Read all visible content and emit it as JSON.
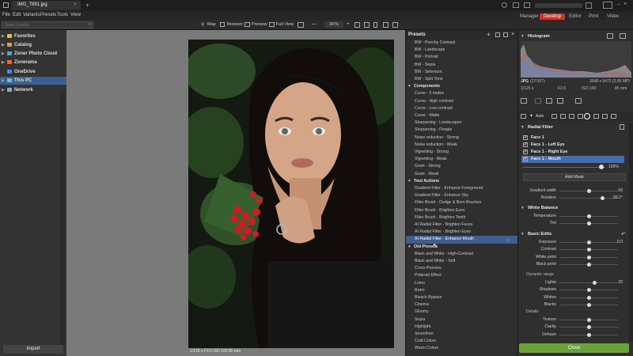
{
  "window": {
    "title": "IMG_7891.jpg",
    "new_tab": "+"
  },
  "menu": [
    "File",
    "Edit",
    "Variants",
    "Presets",
    "Tools",
    "View"
  ],
  "modes": {
    "manager": "Manager",
    "develop": "Develop",
    "editor": "Editor",
    "print": "Print",
    "video": "Video"
  },
  "toolbar": {
    "search_placeholder": "Quick Search",
    "map": "Map",
    "browser": "Browser",
    "preview": "Preview",
    "fullview": "Full View",
    "zoom": "34 %"
  },
  "navigator": [
    {
      "label": "Favorites",
      "color": "#e0c040"
    },
    {
      "label": "Catalog",
      "color": "#c9a35a"
    },
    {
      "label": "Zoner Photo Cloud",
      "color": "#5aa0e0"
    },
    {
      "label": "Zonerama",
      "color": "#e06a3a"
    },
    {
      "label": "OneDrive",
      "color": "#4a90d9"
    },
    {
      "label": "This PC",
      "color": "#7ab0e0"
    },
    {
      "label": "Network",
      "color": "#7ab0e0"
    }
  ],
  "left_footer": {
    "import": "Import"
  },
  "image_info": "1/125 s   F3.5   ISO 100   85 mm",
  "presets": {
    "title": "Presets",
    "items": [
      {
        "type": "item",
        "label": "BW - Punchy Contrast"
      },
      {
        "type": "item",
        "label": "BW - Landscape"
      },
      {
        "type": "item",
        "label": "BW - Portrait"
      },
      {
        "type": "item",
        "label": "BW - Sepia"
      },
      {
        "type": "item",
        "label": "BW - Selenium"
      },
      {
        "type": "item",
        "label": "BW - Split Tone"
      },
      {
        "type": "header",
        "label": "Components"
      },
      {
        "type": "item",
        "label": "Curve - 5 nodes"
      },
      {
        "type": "item",
        "label": "Curve - High contrast"
      },
      {
        "type": "item",
        "label": "Curve - Low contrast"
      },
      {
        "type": "item",
        "label": "Curve - Matte"
      },
      {
        "type": "item",
        "label": "Sharpening - Landscapes"
      },
      {
        "type": "item",
        "label": "Sharpening - People"
      },
      {
        "type": "item",
        "label": "Noise reduction - Strong"
      },
      {
        "type": "item",
        "label": "Noise reduction - Weak"
      },
      {
        "type": "item",
        "label": "Vignetting - Strong"
      },
      {
        "type": "item",
        "label": "Vignetting - Weak"
      },
      {
        "type": "item",
        "label": "Grain - Strong"
      },
      {
        "type": "item",
        "label": "Grain - Weak"
      },
      {
        "type": "header",
        "label": "Tool Actions"
      },
      {
        "type": "item",
        "label": "Gradient Filter - Enhance Foreground"
      },
      {
        "type": "item",
        "label": "Gradient Filter - Enhance Sky"
      },
      {
        "type": "item",
        "label": "Filter Brush - Dodge & Burn Brushes"
      },
      {
        "type": "item",
        "label": "Filter Brush - Brighten Eyes"
      },
      {
        "type": "item",
        "label": "Filter Brush - Brighten Teeth"
      },
      {
        "type": "item",
        "label": "AI Radial Filter - Brighten Faces"
      },
      {
        "type": "item",
        "label": "AI Radial Filter - Brighten Eyes"
      },
      {
        "type": "item",
        "label": "AI Radial Filter - Enhance Mouth",
        "selected": true
      },
      {
        "type": "header",
        "label": "Old Presets"
      },
      {
        "type": "item",
        "label": "Black and White - High-Contrast"
      },
      {
        "type": "item",
        "label": "Black and White - Soft"
      },
      {
        "type": "item",
        "label": "Cross Process"
      },
      {
        "type": "item",
        "label": "Polaroid Effect"
      },
      {
        "type": "item",
        "label": "Lomo"
      },
      {
        "type": "item",
        "label": "Retro"
      },
      {
        "type": "item",
        "label": "Bleach Bypass"
      },
      {
        "type": "item",
        "label": "Cinema"
      },
      {
        "type": "item",
        "label": "Gloomy"
      },
      {
        "type": "item",
        "label": "Sepia"
      },
      {
        "type": "item",
        "label": "Highlight"
      },
      {
        "type": "item",
        "label": "Smoothen"
      },
      {
        "type": "item",
        "label": "Cold Colors"
      },
      {
        "type": "item",
        "label": "Warm Colors"
      }
    ]
  },
  "histogram": {
    "title": "Histogram",
    "format": "JPG",
    "bitinfo": "(27/167)",
    "dims": "3648 x 5472 (3.96 MP)",
    "shutter": "1/125 s",
    "aperture": "F3.5",
    "iso": "ISO 100",
    "focal": "85 mm"
  },
  "auto_label": "Auto",
  "radial": {
    "title": "Radial Filter",
    "layers": [
      {
        "label": "Face 1",
        "checked": true
      },
      {
        "label": "Face 1 - Left Eye",
        "checked": true
      },
      {
        "label": "Face 1 - Right Eye",
        "checked": true
      },
      {
        "label": "Face 1 - Mouth",
        "checked": true,
        "selected": true
      }
    ],
    "opacity": "100%",
    "add_mask": "Add Mask",
    "gradient_width": {
      "label": "Gradient width",
      "value": "50",
      "pos": 0.5
    },
    "rotation": {
      "label": "Rotation",
      "value": "99.2°",
      "pos": 0.73
    }
  },
  "white_balance": {
    "title": "White Balance",
    "rows": [
      {
        "label": "Temperature",
        "pos": 0.5
      },
      {
        "label": "Tint",
        "pos": 0.5
      }
    ]
  },
  "basic_edits": {
    "title": "Basic Edits",
    "rows": [
      {
        "label": "Exposure",
        "value": "0.0",
        "pos": 0.5
      },
      {
        "label": "Contrast",
        "value": "",
        "pos": 0.5
      },
      {
        "label": "White point",
        "value": "",
        "pos": 0.5
      },
      {
        "label": "Black point",
        "value": "",
        "pos": 0.5
      }
    ],
    "dynamic_label": "Dynamic range",
    "dynamic_rows": [
      {
        "label": "Lights",
        "value": "20",
        "pos": 0.6
      },
      {
        "label": "Shadows",
        "value": "",
        "pos": 0.5
      },
      {
        "label": "Whites",
        "value": "",
        "pos": 0.5
      },
      {
        "label": "Blacks",
        "value": "",
        "pos": 0.5
      }
    ],
    "details_label": "Details",
    "detail_rows": [
      {
        "label": "Texture",
        "value": "",
        "pos": 0.5
      },
      {
        "label": "Clarity",
        "value": "",
        "pos": 0.5
      },
      {
        "label": "Dehaze",
        "value": "",
        "pos": 0.5
      }
    ]
  },
  "close_label": "Close"
}
